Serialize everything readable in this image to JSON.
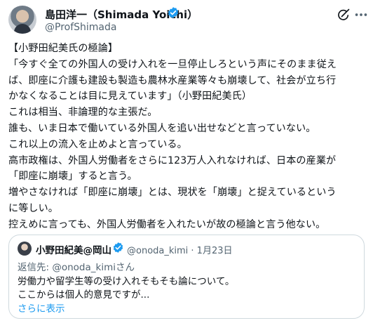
{
  "author": {
    "name": "島田洋一（Shimada Yoichi）",
    "handle": "@ProfShimada"
  },
  "icons": {
    "verified": "verified-badge-icon",
    "grok": "grok-icon",
    "more": "more-options-icon"
  },
  "colors": {
    "accent": "#1d9bf0",
    "secondary_text": "#536471",
    "border": "#cfd9de"
  },
  "tweet": {
    "lines": [
      "【小野田紀美氏の極論】",
      "「今すぐ全ての外国人の受け入れを一旦停止しろという声にそのまま従え",
      "ば、即座に介護も建設も製造も農林水産業等々も崩壊して、社会が立ち行",
      "かなくなることは目に見えています」（小野田紀美氏）",
      "これは相当、非論理的な主張だ。",
      "誰も、いま日本で働いている外国人を追い出せなどと言っていない。",
      "これ以上の流入を止めよと言っている。",
      "高市政権は、外国人労働者をさらに123万人入れなければ、日本の産業が",
      "「即座に崩壊」すると言う。",
      "増やさなければ「即座に崩壊」とは、現状を「崩壊」と捉えているという",
      "に等しい。",
      "控えめに言っても、外国人労働者を入れたいが故の極論と言う他ない。"
    ]
  },
  "quote": {
    "name": "小野田紀美@岡山",
    "handle_date": "@onoda_kimi · 1月23日",
    "reply_to": "返信先: @onoda_kimiさん",
    "lines": [
      "労働力や留学生等の受け入れそもそも論について。",
      "ここからは個人的意見ですが..."
    ],
    "show_more": "さらに表示"
  }
}
